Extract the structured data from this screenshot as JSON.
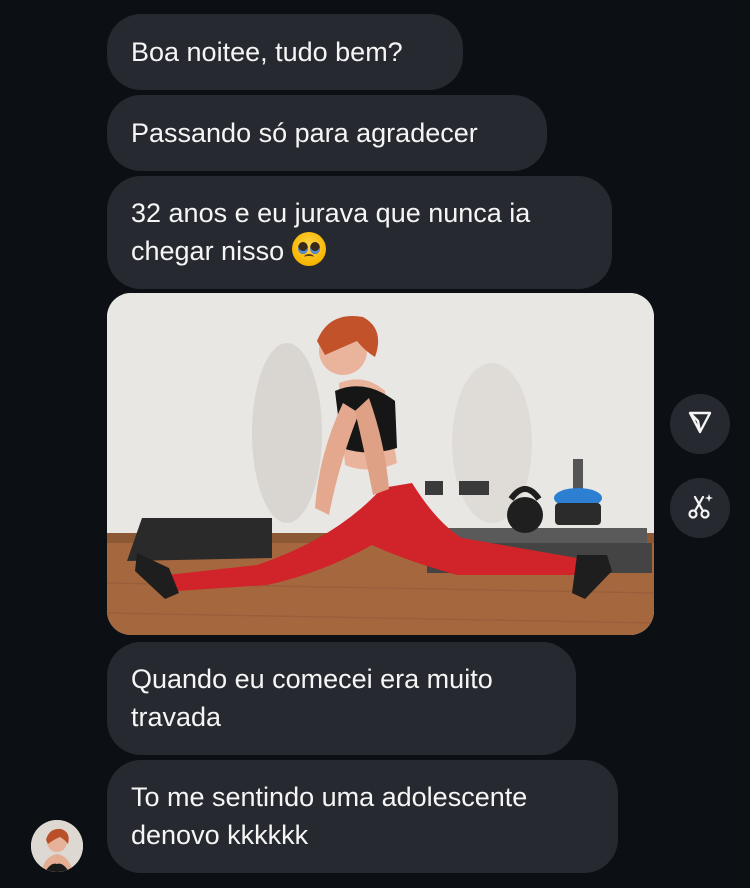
{
  "messages": [
    {
      "text": "Boa noitee, tudo bem?"
    },
    {
      "text": "Passando só para agradecer"
    },
    {
      "line1": "32 anos e eu jurava que nunca ia",
      "line2": "chegar nisso",
      "emoji": "pleading-face-emoji"
    },
    {
      "line1": "Quando eu comecei era muito",
      "line2": "travada"
    },
    {
      "line1": "To me sentindo uma adolescente",
      "line2": "denovo kkkkkk"
    }
  ],
  "media": {
    "description_icon": "photo-woman-doing-splits"
  },
  "actions": {
    "share_icon": "send-paper-plane-icon",
    "ai_icon": "scissors-sparkle-icon"
  },
  "colors": {
    "background": "#0c1014",
    "bubble": "#262a30",
    "text": "#f5f5f5",
    "leggings": "#d0232a"
  }
}
